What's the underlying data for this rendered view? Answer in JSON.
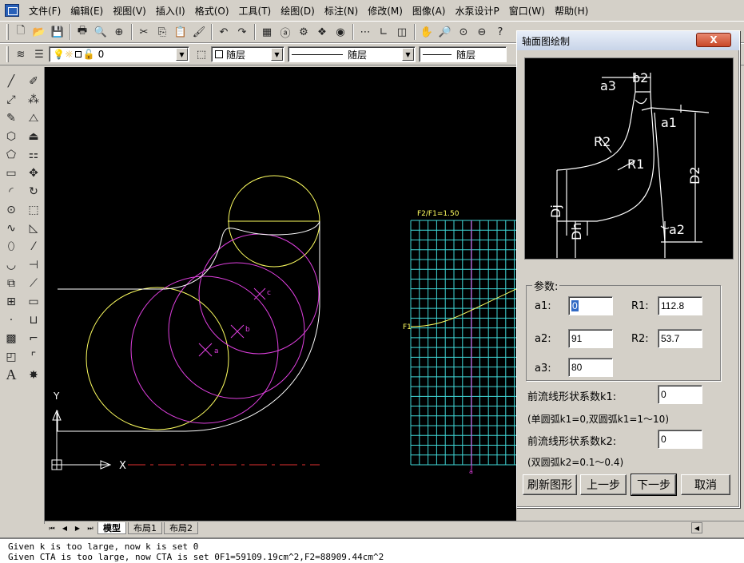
{
  "menubar": {
    "items": [
      "文件(F)",
      "编辑(E)",
      "视图(V)",
      "插入(I)",
      "格式(O)",
      "工具(T)",
      "绘图(D)",
      "标注(N)",
      "修改(M)",
      "图像(A)",
      "水泵设计P",
      "窗口(W)",
      "帮助(H)"
    ]
  },
  "toolbar2": {
    "layer_value": "0",
    "color_value": "随层",
    "linetype_value": "随层",
    "lineweight_value": "随层"
  },
  "drawing": {
    "grid_label": "F2/F1=1.50",
    "f1_label": "F1",
    "point_a": "a",
    "point_b": "b",
    "point_c": "c",
    "axis_y": "Y",
    "axis_x": "X",
    "grid_bottom_label": "a"
  },
  "tabs": [
    "模型",
    "布局1",
    "布局2"
  ],
  "cmdline": {
    "line1": "Given k is too large, now k is set 0",
    "line2": "Given CTA is too large, now CTA is set 0F1=59109.19cm^2,F2=88909.44cm^2"
  },
  "dialog": {
    "title": "轴面图绘制",
    "close_label": "X",
    "preview_labels": {
      "a3": "a3",
      "b2": "b2",
      "a1": "a1",
      "R2": "R2",
      "R1": "R1",
      "D2": "D2",
      "Dj": "Dj",
      "Dh": "Dh",
      "a2": "a2"
    },
    "params_legend": "参数:",
    "a1_label": "a1:",
    "a1_value": "0",
    "a2_label": "a2:",
    "a2_value": "91",
    "a3_label": "a3:",
    "a3_value": "80",
    "R1_label": "R1:",
    "R1_value": "112.8",
    "R2_label": "R2:",
    "R2_value": "53.7",
    "k1_label": "前流线形状系数k1:",
    "k1_value": "0",
    "k1_hint": "(单圆弧k1=0,双圆弧k1=1～10)",
    "k2_label": "前流线形状系数k2:",
    "k2_value": "0",
    "k2_hint": "(双圆弧k2=0.1～0.4)",
    "btn_refresh": "刷新图形",
    "btn_prev": "上一步",
    "btn_next": "下一步",
    "btn_cancel": "取消"
  },
  "colors": {
    "canvas_bg": "#000000",
    "yellow": "#ffff60",
    "magenta": "#e040e0",
    "cyan": "#40d8d8",
    "red": "#e03030",
    "white": "#ffffff"
  }
}
